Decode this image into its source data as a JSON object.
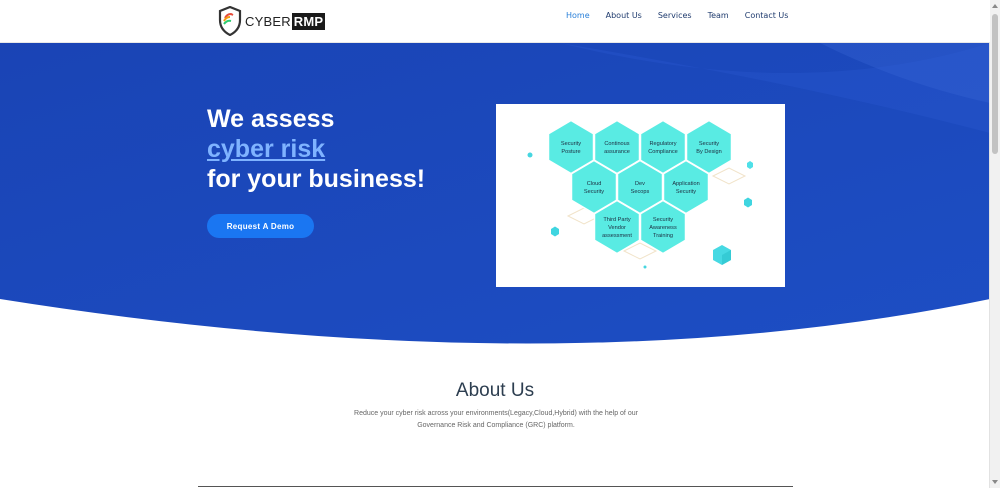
{
  "brand": {
    "logo_text": "CYBER",
    "logo_box": "RMP",
    "logo_alt": "CyberRMP"
  },
  "nav": {
    "items": [
      {
        "label": "Home",
        "active": true
      },
      {
        "label": "About Us",
        "active": false
      },
      {
        "label": "Services",
        "active": false
      },
      {
        "label": "Team",
        "active": false
      },
      {
        "label": "Contact Us",
        "active": false
      }
    ]
  },
  "hero": {
    "line1": "We assess",
    "highlight": "cyber risk",
    "line3": "for your business!",
    "cta_label": "Request A Demo"
  },
  "diagram": {
    "hexagons": [
      "Security\nPosture",
      "Continous\nassurance",
      "Regulatory\nCompliance",
      "Security\nBy Design",
      "Cloud\nSecurity",
      "Dev\nSecops",
      "Application\nSecurity",
      "Third Party\nVendor\nassessment",
      "Security\nAwareness\nTraining"
    ]
  },
  "about": {
    "title": "About Us",
    "text": "Reduce your cyber risk across your environments(Legacy,Cloud,Hybrid) with the help of our Governance Risk and Compliance (GRC) platform."
  },
  "colors": {
    "hero_blue": "#1e48b8",
    "hero_blue_dark": "#1337a0",
    "accent": "#1a76f2",
    "hexagon": "#59ebe3",
    "nav_active": "#2a80d9",
    "nav_text": "#1f3b6e"
  }
}
